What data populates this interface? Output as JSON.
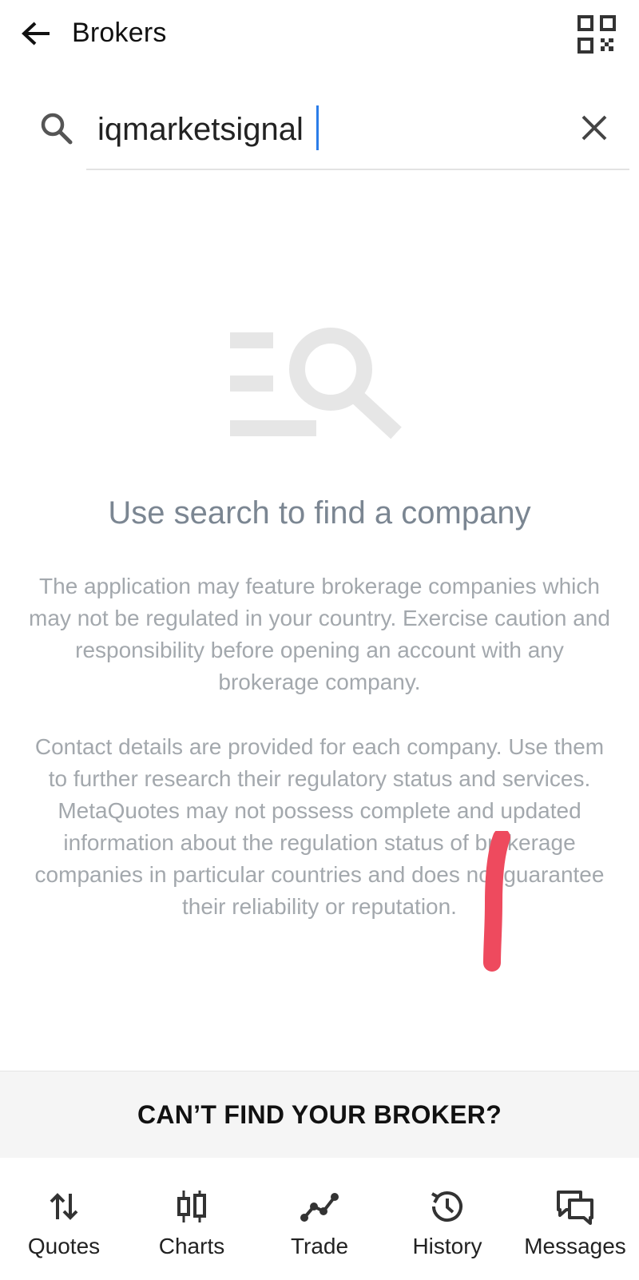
{
  "header": {
    "title": "Brokers",
    "back_icon": "arrow-left-icon",
    "qr_icon": "qr-code-icon"
  },
  "search": {
    "value": "iqmarketsignal",
    "placeholder": "",
    "search_icon": "search-icon",
    "clear_icon": "close-icon",
    "caret_color": "#2b7de9"
  },
  "empty_state": {
    "illustration_icon": "list-search-icon",
    "heading": "Use search to find a company",
    "paragraph_1": "The application may feature brokerage companies which may not be regulated in your country. Exercise caution and responsibility before opening an account with any brokerage company.",
    "paragraph_2": "Contact details are provided for each company. Use them to further research their regulatory status and services. MetaQuotes may not possess complete and updated information about the regulation status of brokerage companies in particular countries and does not guarantee their reliability or reputation."
  },
  "annotation": {
    "color": "#ee4a5e"
  },
  "cta": {
    "label": "CAN’T FIND YOUR BROKER?"
  },
  "bottom_nav": {
    "items": [
      {
        "label": "Quotes",
        "icon": "up-down-arrows-icon"
      },
      {
        "label": "Charts",
        "icon": "candlestick-icon"
      },
      {
        "label": "Trade",
        "icon": "trend-line-icon"
      },
      {
        "label": "History",
        "icon": "history-clock-icon"
      },
      {
        "label": "Messages",
        "icon": "chat-bubbles-icon"
      }
    ]
  },
  "colors": {
    "heading_text": "#7b8692",
    "body_text": "#a3a8ad",
    "illustration": "#e6e6e6",
    "cta_background": "#f5f5f5"
  }
}
